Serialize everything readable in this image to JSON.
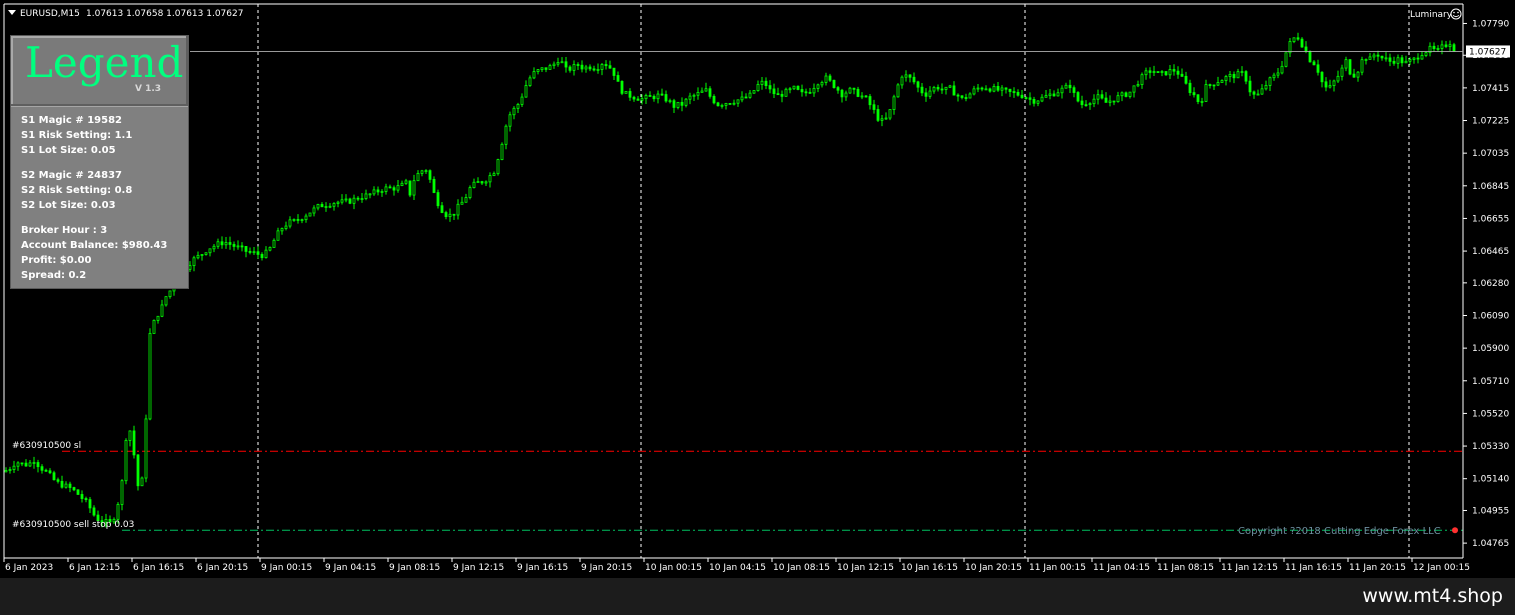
{
  "chart_header": {
    "symbol": "EURUSD,M15",
    "ohlc": "1.07613 1.07658 1.07613 1.07627"
  },
  "indicator_name": "Luminary",
  "smiley_icon": "smiley-icon",
  "legend": {
    "title": "Legend",
    "version": "V 1.3",
    "lines": [
      [
        "S1 Magic # 19582",
        "S1 Risk Setting: 1.1",
        "S1 Lot Size: 0.05"
      ],
      [
        "S2 Magic # 24837",
        "S2 Risk Setting: 0.8",
        "S2 Lot Size: 0.03"
      ],
      [
        "Broker Hour : 3",
        "Account Balance: $980.43",
        "Profit: $0.00",
        "Spread:  0.2"
      ]
    ]
  },
  "order_labels": {
    "sl": "#630910500 sl",
    "sell_stop": "#630910500 sell stop 0.03"
  },
  "copyright": "Copyright ?2018 Cutting Edge Forex LLC",
  "watermark": "www.mt4.shop",
  "colors": {
    "background": "#000000",
    "candle": "#00ff00",
    "sl_line": "#ff0000",
    "order_line": "#00c060",
    "grid": "#ffffff",
    "legend_title": "#00ff7f",
    "copyright": "#6e8fa0"
  },
  "chart_data": {
    "type": "candlestick",
    "symbol": "EURUSD",
    "timeframe": "M15",
    "price_ticks": [
      "1.07790",
      "1.07605",
      "1.07415",
      "1.07225",
      "1.07035",
      "1.06845",
      "1.06655",
      "1.06465",
      "1.06280",
      "1.06090",
      "1.05900",
      "1.05710",
      "1.05520",
      "1.05330",
      "1.05140",
      "1.04955",
      "1.04765"
    ],
    "current_price": "1.07627",
    "ylim": [
      1.0469,
      1.0788
    ],
    "time_ticks": [
      "6 Jan 2023",
      "6 Jan 12:15",
      "6 Jan 16:15",
      "6 Jan 20:15",
      "9 Jan 00:15",
      "9 Jan 04:15",
      "9 Jan 08:15",
      "9 Jan 12:15",
      "9 Jan 16:15",
      "9 Jan 20:15",
      "10 Jan 00:15",
      "10 Jan 04:15",
      "10 Jan 08:15",
      "10 Jan 12:15",
      "10 Jan 16:15",
      "10 Jan 20:15",
      "11 Jan 00:15",
      "11 Jan 04:15",
      "11 Jan 08:15",
      "11 Jan 12:15",
      "11 Jan 16:15",
      "11 Jan 20:15",
      "12 Jan 00:15"
    ],
    "day_separators": [
      "9 Jan 00:00",
      "10 Jan 00:00",
      "11 Jan 00:00",
      "12 Jan 00:00"
    ],
    "sl_level": 1.053,
    "sell_stop_level": 1.0484,
    "close_path": [
      [
        0,
        1.0518
      ],
      [
        8,
        1.0519
      ],
      [
        16,
        1.0524
      ],
      [
        24,
        1.0522
      ],
      [
        30,
        1.0523
      ],
      [
        34,
        1.0525
      ],
      [
        40,
        1.0521
      ],
      [
        48,
        1.0517
      ],
      [
        56,
        1.0512
      ],
      [
        64,
        1.051
      ],
      [
        72,
        1.0508
      ],
      [
        80,
        1.0504
      ],
      [
        88,
        1.0499
      ],
      [
        96,
        1.0491
      ],
      [
        104,
        1.0489
      ],
      [
        110,
        1.0488
      ],
      [
        116,
        1.0494
      ],
      [
        122,
        1.0512
      ],
      [
        126,
        1.0538
      ],
      [
        130,
        1.0542
      ],
      [
        134,
        1.0528
      ],
      [
        138,
        1.051
      ],
      [
        142,
        1.0513
      ],
      [
        146,
        1.055
      ],
      [
        150,
        1.0598
      ],
      [
        154,
        1.0605
      ],
      [
        158,
        1.061
      ],
      [
        162,
        1.0614
      ],
      [
        166,
        1.062
      ],
      [
        172,
        1.0625
      ],
      [
        178,
        1.063
      ],
      [
        184,
        1.0636
      ],
      [
        192,
        1.0641
      ],
      [
        200,
        1.0644
      ],
      [
        208,
        1.0648
      ],
      [
        216,
        1.065
      ],
      [
        224,
        1.0652
      ],
      [
        232,
        1.065
      ],
      [
        240,
        1.0648
      ],
      [
        248,
        1.0646
      ],
      [
        256,
        1.0645
      ],
      [
        264,
        1.0644
      ],
      [
        270,
        1.0648
      ],
      [
        276,
        1.0655
      ],
      [
        282,
        1.066
      ],
      [
        288,
        1.0663
      ],
      [
        296,
        1.0664
      ],
      [
        304,
        1.0667
      ],
      [
        312,
        1.067
      ],
      [
        320,
        1.0673
      ],
      [
        328,
        1.0674
      ],
      [
        336,
        1.0675
      ],
      [
        344,
        1.0675
      ],
      [
        352,
        1.0676
      ],
      [
        360,
        1.0678
      ],
      [
        368,
        1.0679
      ],
      [
        376,
        1.0681
      ],
      [
        384,
        1.0683
      ],
      [
        392,
        1.0683
      ],
      [
        400,
        1.0684
      ],
      [
        406,
        1.0686
      ],
      [
        410,
        1.068
      ],
      [
        414,
        1.0688
      ],
      [
        420,
        1.0693
      ],
      [
        426,
        1.0694
      ],
      [
        430,
        1.0688
      ],
      [
        434,
        1.068
      ],
      [
        440,
        1.0672
      ],
      [
        446,
        1.0668
      ],
      [
        452,
        1.0667
      ],
      [
        458,
        1.0672
      ],
      [
        464,
        1.0676
      ],
      [
        470,
        1.0683
      ],
      [
        476,
        1.0686
      ],
      [
        482,
        1.0687
      ],
      [
        488,
        1.0689
      ],
      [
        494,
        1.0693
      ],
      [
        500,
        1.0705
      ],
      [
        504,
        1.0715
      ],
      [
        508,
        1.0724
      ],
      [
        512,
        1.0728
      ],
      [
        516,
        1.073
      ],
      [
        520,
        1.0734
      ],
      [
        524,
        1.074
      ],
      [
        528,
        1.0746
      ],
      [
        534,
        1.075
      ],
      [
        540,
        1.0752
      ],
      [
        546,
        1.0753
      ],
      [
        552,
        1.0754
      ],
      [
        558,
        1.0758
      ],
      [
        562,
        1.0756
      ],
      [
        566,
        1.0752
      ],
      [
        572,
        1.0753
      ],
      [
        578,
        1.0755
      ],
      [
        584,
        1.0753
      ],
      [
        590,
        1.0754
      ],
      [
        596,
        1.0753
      ],
      [
        602,
        1.0756
      ],
      [
        608,
        1.0755
      ],
      [
        614,
        1.075
      ],
      [
        618,
        1.0744
      ],
      [
        624,
        1.0738
      ],
      [
        630,
        1.0737
      ],
      [
        636,
        1.0736
      ],
      [
        642,
        1.0735
      ],
      [
        650,
        1.0736
      ],
      [
        658,
        1.0737
      ],
      [
        666,
        1.0735
      ],
      [
        674,
        1.0731
      ],
      [
        682,
        1.0732
      ],
      [
        690,
        1.0736
      ],
      [
        698,
        1.0738
      ],
      [
        706,
        1.074
      ],
      [
        712,
        1.0735
      ],
      [
        718,
        1.0732
      ],
      [
        726,
        1.0733
      ],
      [
        734,
        1.0734
      ],
      [
        742,
        1.0735
      ],
      [
        750,
        1.0737
      ],
      [
        758,
        1.0743
      ],
      [
        764,
        1.0745
      ],
      [
        770,
        1.074
      ],
      [
        778,
        1.0737
      ],
      [
        786,
        1.0739
      ],
      [
        794,
        1.0741
      ],
      [
        802,
        1.0738
      ],
      [
        810,
        1.074
      ],
      [
        818,
        1.0745
      ],
      [
        826,
        1.0747
      ],
      [
        834,
        1.0743
      ],
      [
        842,
        1.0738
      ],
      [
        850,
        1.074
      ],
      [
        858,
        1.0738
      ],
      [
        866,
        1.0735
      ],
      [
        872,
        1.073
      ],
      [
        878,
        1.0724
      ],
      [
        884,
        1.0721
      ],
      [
        890,
        1.0728
      ],
      [
        896,
        1.074
      ],
      [
        902,
        1.0749
      ],
      [
        908,
        1.0748
      ],
      [
        914,
        1.0745
      ],
      [
        920,
        1.074
      ],
      [
        926,
        1.0738
      ],
      [
        932,
        1.0741
      ],
      [
        938,
        1.0742
      ],
      [
        944,
        1.074
      ],
      [
        950,
        1.0741
      ],
      [
        956,
        1.0738
      ],
      [
        962,
        1.0735
      ],
      [
        968,
        1.0737
      ],
      [
        976,
        1.0741
      ],
      [
        984,
        1.0742
      ],
      [
        992,
        1.0741
      ],
      [
        1000,
        1.074
      ],
      [
        1008,
        1.0739
      ],
      [
        1016,
        1.0738
      ],
      [
        1024,
        1.0737
      ],
      [
        1032,
        1.0734
      ],
      [
        1040,
        1.0735
      ],
      [
        1048,
        1.0737
      ],
      [
        1056,
        1.0739
      ],
      [
        1064,
        1.0741
      ],
      [
        1070,
        1.0743
      ],
      [
        1076,
        1.0735
      ],
      [
        1082,
        1.0732
      ],
      [
        1090,
        1.0734
      ],
      [
        1098,
        1.0736
      ],
      [
        1106,
        1.0733
      ],
      [
        1114,
        1.0735
      ],
      [
        1122,
        1.0737
      ],
      [
        1130,
        1.0739
      ],
      [
        1138,
        1.0745
      ],
      [
        1146,
        1.075
      ],
      [
        1152,
        1.0752
      ],
      [
        1160,
        1.0749
      ],
      [
        1168,
        1.0751
      ],
      [
        1176,
        1.0752
      ],
      [
        1184,
        1.0745
      ],
      [
        1190,
        1.074
      ],
      [
        1196,
        1.0736
      ],
      [
        1200,
        1.0732
      ],
      [
        1206,
        1.0742
      ],
      [
        1212,
        1.0744
      ],
      [
        1220,
        1.0746
      ],
      [
        1228,
        1.0748
      ],
      [
        1236,
        1.0749
      ],
      [
        1244,
        1.075
      ],
      [
        1250,
        1.074
      ],
      [
        1256,
        1.0736
      ],
      [
        1262,
        1.074
      ],
      [
        1268,
        1.0745
      ],
      [
        1274,
        1.0748
      ],
      [
        1280,
        1.0752
      ],
      [
        1286,
        1.0762
      ],
      [
        1292,
        1.077
      ],
      [
        1298,
        1.0771
      ],
      [
        1304,
        1.0765
      ],
      [
        1310,
        1.0758
      ],
      [
        1316,
        1.0755
      ],
      [
        1322,
        1.0745
      ],
      [
        1328,
        1.074
      ],
      [
        1334,
        1.0745
      ],
      [
        1340,
        1.075
      ],
      [
        1346,
        1.0757
      ],
      [
        1352,
        1.0748
      ],
      [
        1358,
        1.0752
      ],
      [
        1364,
        1.076
      ],
      [
        1370,
        1.0758
      ],
      [
        1376,
        1.0762
      ],
      [
        1382,
        1.0759
      ],
      [
        1390,
        1.0757
      ],
      [
        1398,
        1.0758
      ],
      [
        1406,
        1.0756
      ],
      [
        1414,
        1.0758
      ],
      [
        1422,
        1.0762
      ],
      [
        1430,
        1.0764
      ],
      [
        1438,
        1.0763
      ],
      [
        1444,
        1.0766
      ],
      [
        1450,
        1.0768
      ],
      [
        1455,
        1.0763
      ]
    ]
  }
}
